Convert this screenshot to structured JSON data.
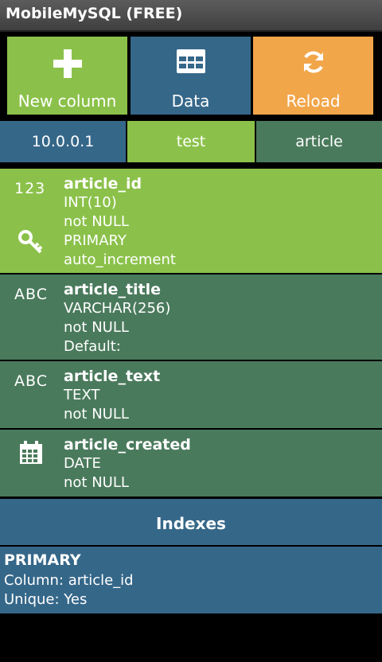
{
  "app": {
    "title": "MobileMySQL (FREE)"
  },
  "toolbar": {
    "new_column": "New column",
    "data": "Data",
    "reload": "Reload"
  },
  "breadcrumb": [
    "10.0.0.1",
    "test",
    "article"
  ],
  "columns": [
    {
      "type_icon": "123",
      "name": "article_id",
      "attrs": [
        "INT(10)",
        "not NULL",
        "PRIMARY",
        "auto_increment"
      ],
      "has_key_icon": true
    },
    {
      "type_icon": "ABC",
      "name": "article_title",
      "attrs": [
        "VARCHAR(256)",
        "not NULL",
        "Default:"
      ]
    },
    {
      "type_icon": "ABC",
      "name": "article_text",
      "attrs": [
        "TEXT",
        "not NULL"
      ]
    },
    {
      "type_icon": "calendar-icon",
      "name": "article_created",
      "attrs": [
        "DATE",
        "not NULL"
      ]
    }
  ],
  "indexes": {
    "header": "Indexes",
    "items": [
      {
        "name": "PRIMARY",
        "column": "Column: article_id",
        "unique": "Unique: Yes"
      }
    ]
  },
  "colors": {
    "green": "#8bc14a",
    "blue": "#356789",
    "orange": "#f2a64a",
    "teal": "#4a7a5c"
  }
}
